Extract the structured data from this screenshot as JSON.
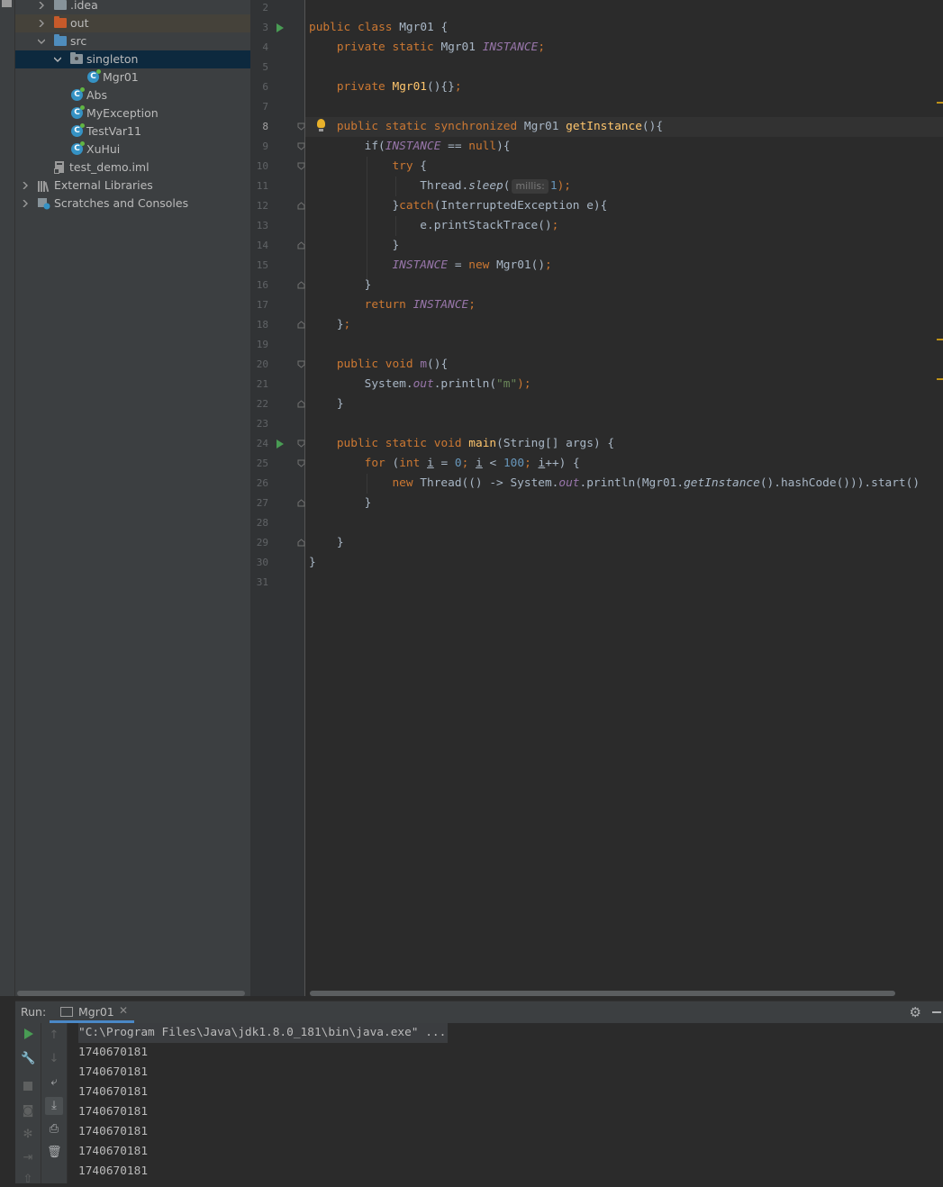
{
  "project_tree": [
    {
      "label": ".idea",
      "icon": "folder-icon",
      "depth": 1,
      "expanded": false
    },
    {
      "label": "out",
      "icon": "folder-orange-icon",
      "depth": 1,
      "expanded": false
    },
    {
      "label": "src",
      "icon": "folder-blue-icon",
      "depth": 1,
      "expanded": true
    },
    {
      "label": "singleton",
      "icon": "package-icon",
      "depth": 2,
      "expanded": true,
      "selected": true
    },
    {
      "label": "Mgr01",
      "icon": "class-icon",
      "depth": 3
    },
    {
      "label": "Abs",
      "icon": "class-icon",
      "depth": 2
    },
    {
      "label": "MyException",
      "icon": "class-icon",
      "depth": 2
    },
    {
      "label": "TestVar11",
      "icon": "class-icon",
      "depth": 2
    },
    {
      "label": "XuHui",
      "icon": "class-icon",
      "depth": 2
    },
    {
      "label": "test_demo.iml",
      "icon": "module-file-icon",
      "depth": 1
    },
    {
      "label": "External Libraries",
      "icon": "libraries-icon",
      "depth": 0,
      "expanded": false
    },
    {
      "label": "Scratches and Consoles",
      "icon": "scratches-icon",
      "depth": 0,
      "expanded": false
    }
  ],
  "editor": {
    "current_line": "8",
    "line_numbers": [
      "2",
      "3",
      "4",
      "5",
      "6",
      "7",
      "8",
      "9",
      "10",
      "11",
      "12",
      "13",
      "14",
      "15",
      "16",
      "17",
      "18",
      "19",
      "20",
      "21",
      "22",
      "23",
      "24",
      "25",
      "26",
      "27",
      "28",
      "29",
      "30",
      "31"
    ],
    "code": {
      "l3": [
        "public",
        "class",
        "Mgr01",
        "{"
      ],
      "l4": [
        "private",
        "static",
        "Mgr01",
        "INSTANCE",
        ";"
      ],
      "l6": [
        "private",
        "Mgr01",
        "(){}",
        ";"
      ],
      "l8": [
        "public",
        "static",
        "synchronized",
        "Mgr01",
        "getInstance",
        "(){"
      ],
      "l9": [
        "if(",
        "INSTANCE",
        "==",
        "null",
        "){"
      ],
      "l10": [
        "try",
        "{"
      ],
      "l11": [
        "Thread.",
        "sleep",
        "(",
        "millis:",
        "1",
        ");"
      ],
      "l12": [
        "}",
        "catch",
        "(InterruptedException e){"
      ],
      "l13": [
        "e.printStackTrace()",
        ";"
      ],
      "l14": [
        "}"
      ],
      "l15": [
        "INSTANCE",
        "=",
        "new",
        "Mgr01()",
        ";"
      ],
      "l16": [
        "}"
      ],
      "l17": [
        "return",
        "INSTANCE",
        ";"
      ],
      "l18": [
        "}",
        ";"
      ],
      "l20": [
        "public",
        "void",
        "m",
        "(){"
      ],
      "l21": [
        "System.",
        "out",
        ".println(",
        "\"m\"",
        ");"
      ],
      "l22": [
        "}"
      ],
      "l24": [
        "public",
        "static",
        "void",
        "main",
        "(String[] args) {"
      ],
      "l25": [
        "for",
        "(",
        "int",
        "i",
        "=",
        "0",
        ";",
        "i",
        "<",
        "100",
        ";",
        "i",
        "++) {"
      ],
      "l26": [
        "new",
        "Thread(() -> System.",
        "out",
        ".println(Mgr01.",
        "getInstance",
        "().hashCode())).start()"
      ],
      "l27": [
        "}"
      ],
      "l29": [
        "}"
      ],
      "l30": [
        "}"
      ]
    }
  },
  "run_panel": {
    "label": "Run:",
    "tab_label": "Mgr01",
    "command": "\"C:\\Program Files\\Java\\jdk1.8.0_181\\bin\\java.exe\" ...",
    "output": [
      "1740670181",
      "1740670181",
      "1740670181",
      "1740670181",
      "1740670181",
      "1740670181",
      "1740670181"
    ]
  },
  "colors": {
    "keyword": "#cc7832",
    "method": "#ffc66d",
    "static_field": "#9876aa",
    "number": "#6897bb",
    "string": "#6a8759",
    "selection": "#0d293e",
    "run_green": "#499c54"
  }
}
